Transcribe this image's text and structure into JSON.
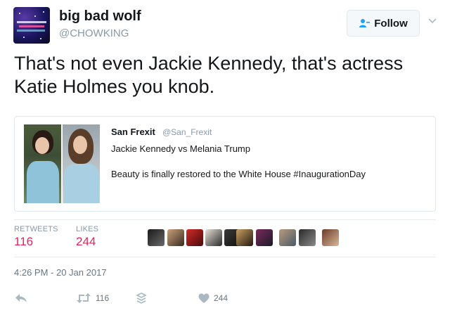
{
  "author": {
    "display_name": "big bad wolf",
    "handle": "@CHOWKING",
    "avatar_icon": "profile-avatar"
  },
  "follow_button": {
    "label": "Follow",
    "icon": "add-user-icon"
  },
  "tweet": {
    "text": "That's not even Jackie Kennedy, that's actress Katie Holmes you knob."
  },
  "quoted_tweet": {
    "display_name": "San Frexit",
    "handle": "@San_Frexit",
    "line1": "Jackie Kennedy vs Melania Trump",
    "line2": "Beauty is finally restored to the White House #InaugurationDay"
  },
  "stats": {
    "retweets_label": "RETWEETS",
    "retweets_value": "116",
    "likes_label": "LIKES",
    "likes_value": "244"
  },
  "timestamp": "4:26 PM - 20 Jan 2017",
  "actions": {
    "retweet_count": "116",
    "like_count": "244"
  },
  "colors": {
    "accent_pink": "#e0245e",
    "muted": "#8899a6",
    "text": "#14171a"
  }
}
